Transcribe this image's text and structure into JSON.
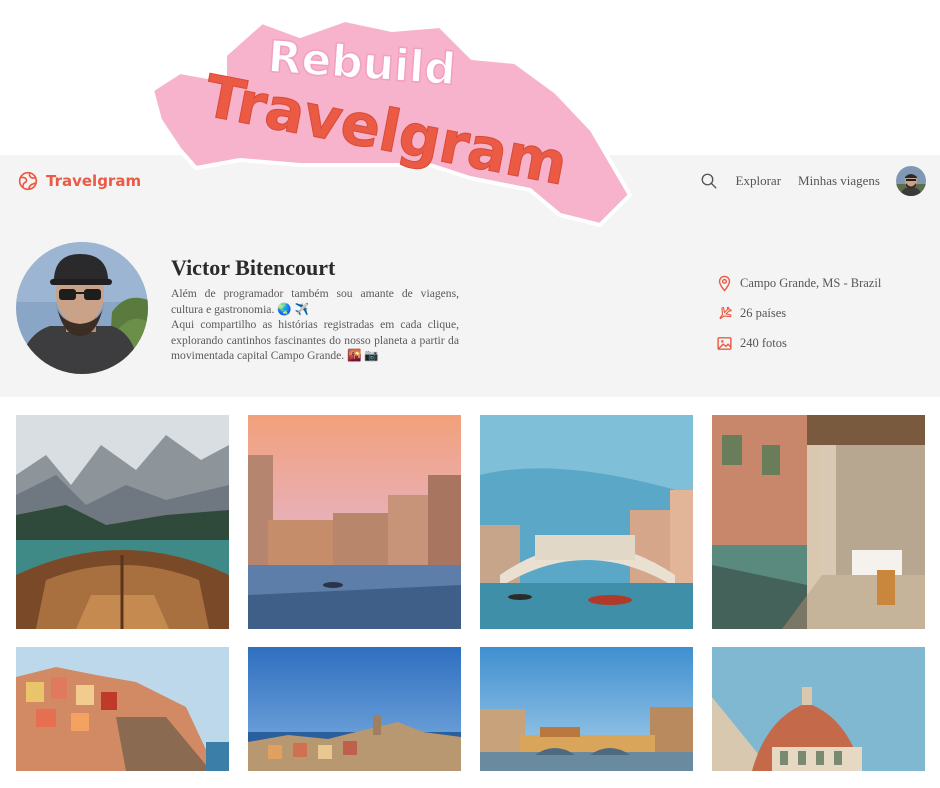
{
  "promo": {
    "line1": "Rebuild",
    "line2": "Travelgram"
  },
  "navbar": {
    "logo_icon": "globe-icon",
    "logo_text": "Travelgram",
    "search_icon": "search-icon",
    "links": [
      "Explorar",
      "Minhas viagens"
    ],
    "avatar": "avatar"
  },
  "profile": {
    "name": "Victor Bitencourt",
    "bio_line1": "Além de programador também sou amante de viagens, cultura e gastronomia. 🌏 ✈️",
    "bio_line2": "Aqui compartilho as histórias registradas em cada clique, explorando cantinhos fascinantes do nosso planeta a partir da movimentada capital Campo Grande. 🌇 📷"
  },
  "stats": [
    {
      "icon": "location-pin-icon",
      "text": "Campo Grande, MS - Brazil"
    },
    {
      "icon": "airplane-icon",
      "text": "26 países"
    },
    {
      "icon": "image-icon",
      "text": "240 fotos"
    }
  ],
  "colors": {
    "accent": "#ea5a44",
    "header_bg": "#f4f4f4",
    "promo_pink": "#f7b3cc",
    "promo_coral": "#ea5a44"
  },
  "gallery": [
    {
      "subject": "mountain-lake-boat"
    },
    {
      "subject": "venice-grand-canal-dusk"
    },
    {
      "subject": "rialto-bridge"
    },
    {
      "subject": "venice-restaurant-canal"
    },
    {
      "subject": "cinque-terre-cliff"
    },
    {
      "subject": "vernazza-coast"
    },
    {
      "subject": "ponte-vecchio"
    },
    {
      "subject": "florence-duomo"
    }
  ]
}
